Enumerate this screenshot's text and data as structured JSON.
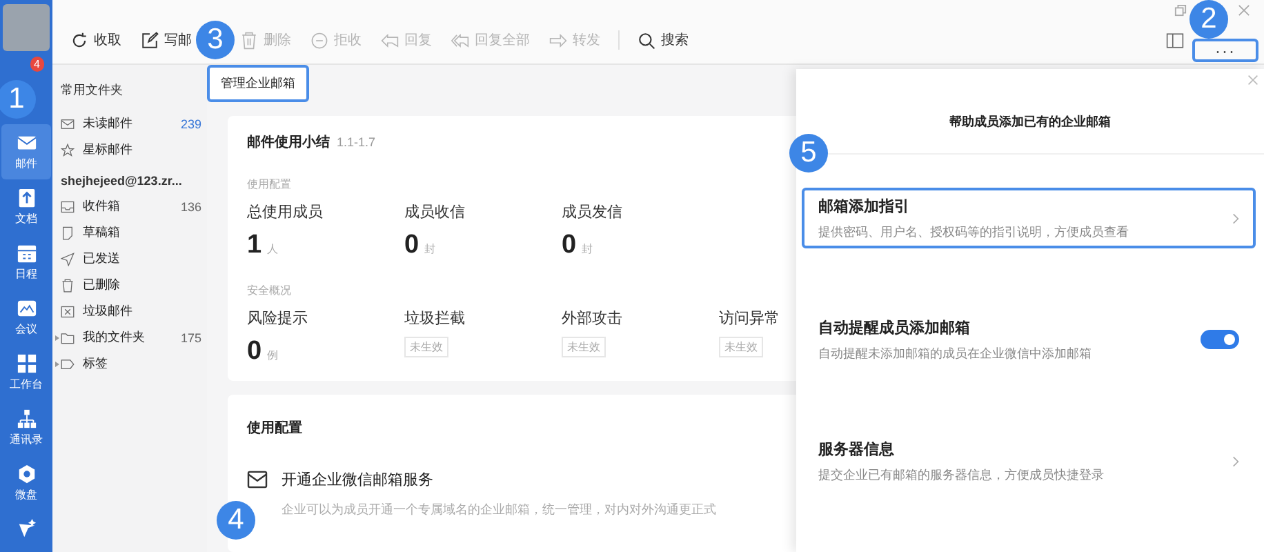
{
  "nav_rail": {
    "badge": "4",
    "items": [
      {
        "label": "邮件",
        "selected": true
      },
      {
        "label": "文档",
        "selected": false
      },
      {
        "label": "日程",
        "selected": false
      },
      {
        "label": "会议",
        "selected": false
      },
      {
        "label": "工作台",
        "selected": false
      },
      {
        "label": "通讯录",
        "selected": false
      },
      {
        "label": "微盘",
        "selected": false
      }
    ]
  },
  "toolbar": {
    "buttons": [
      {
        "label": "收取",
        "disabled": false
      },
      {
        "label": "写邮",
        "disabled": false
      },
      {
        "label": "删除",
        "disabled": true
      },
      {
        "label": "拒收",
        "disabled": true
      },
      {
        "label": "回复",
        "disabled": true
      },
      {
        "label": "回复全部",
        "disabled": true
      },
      {
        "label": "转发",
        "disabled": true
      },
      {
        "label": "搜索",
        "disabled": false
      }
    ],
    "more_button": {
      "label": "···",
      "highlighted": true
    }
  },
  "folders": {
    "common_heading": "常用文件夹",
    "common": [
      {
        "label": "未读邮件",
        "count": "239"
      },
      {
        "label": "星标邮件"
      }
    ],
    "account": "shejhejeed@123.zr...",
    "items": [
      {
        "label": "收件箱",
        "count": "136",
        "expandable": false
      },
      {
        "label": "草稿箱",
        "expandable": false
      },
      {
        "label": "已发送",
        "expandable": false
      },
      {
        "label": "已删除",
        "expandable": false
      },
      {
        "label": "垃圾邮件",
        "expandable": false
      },
      {
        "label": "我的文件夹",
        "count": "175",
        "expandable": true
      },
      {
        "label": "标签",
        "expandable": true
      }
    ]
  },
  "breadcrumb": {
    "label": "管理企业邮箱",
    "highlighted": true
  },
  "summary": {
    "title": "邮件使用小结",
    "range": "1.1-1.7",
    "usage_heading": "使用配置",
    "usage": [
      {
        "label": "总使用成员",
        "value": "1",
        "unit": "人"
      },
      {
        "label": "成员收信",
        "value": "0",
        "unit": "封"
      },
      {
        "label": "成员发信",
        "value": "0",
        "unit": "封"
      }
    ],
    "security_heading": "安全概况",
    "security": [
      {
        "label": "风险提示",
        "kind": "number",
        "value": "0",
        "unit": "例"
      },
      {
        "label": "垃圾拦截",
        "kind": "tag",
        "value": "未生效"
      },
      {
        "label": "外部攻击",
        "kind": "tag",
        "value": "未生效"
      },
      {
        "label": "访问异常",
        "kind": "tag",
        "value": "未生效"
      }
    ]
  },
  "config": {
    "title": "使用配置",
    "item": {
      "title": "开通企业微信邮箱服务",
      "description": "企业可以为成员开通一个专属域名的企业邮箱，统一管理，对内对外沟通更正式"
    }
  },
  "drawer": {
    "title": "帮助成员添加已有的企业邮箱",
    "items": [
      {
        "kind": "link",
        "title": "邮箱添加指引",
        "description": "提供密码、用户名、授权码等的指引说明，方便成员查看",
        "highlighted": true
      },
      {
        "kind": "toggle",
        "title": "自动提醒成员添加邮箱",
        "description": "自动提醒未添加邮箱的成员在企业微信中添加邮箱",
        "on": true
      },
      {
        "kind": "link",
        "title": "服务器信息",
        "description": "提交企业已有邮箱的服务器信息，方便成员快捷登录",
        "highlighted": false
      }
    ]
  },
  "callouts": [
    {
      "number": "1"
    },
    {
      "number": "2"
    },
    {
      "number": "3"
    },
    {
      "number": "4"
    },
    {
      "number": "5"
    }
  ]
}
